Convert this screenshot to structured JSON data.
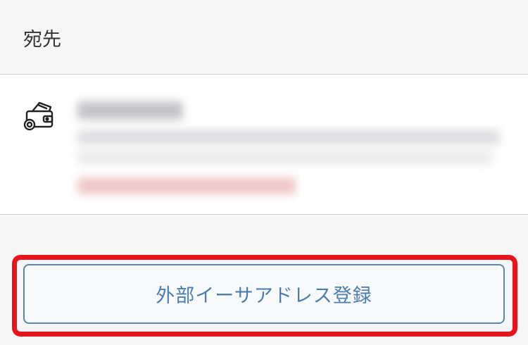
{
  "section": {
    "title": "宛先"
  },
  "address_row": {
    "icon": "wallet-icon"
  },
  "register_button": {
    "label": "外部イーサアドレス登録"
  },
  "colors": {
    "highlight": "#e8141c",
    "button_border": "#5b86b1",
    "button_text": "#4a7db0",
    "background": "#f6f6f7"
  }
}
